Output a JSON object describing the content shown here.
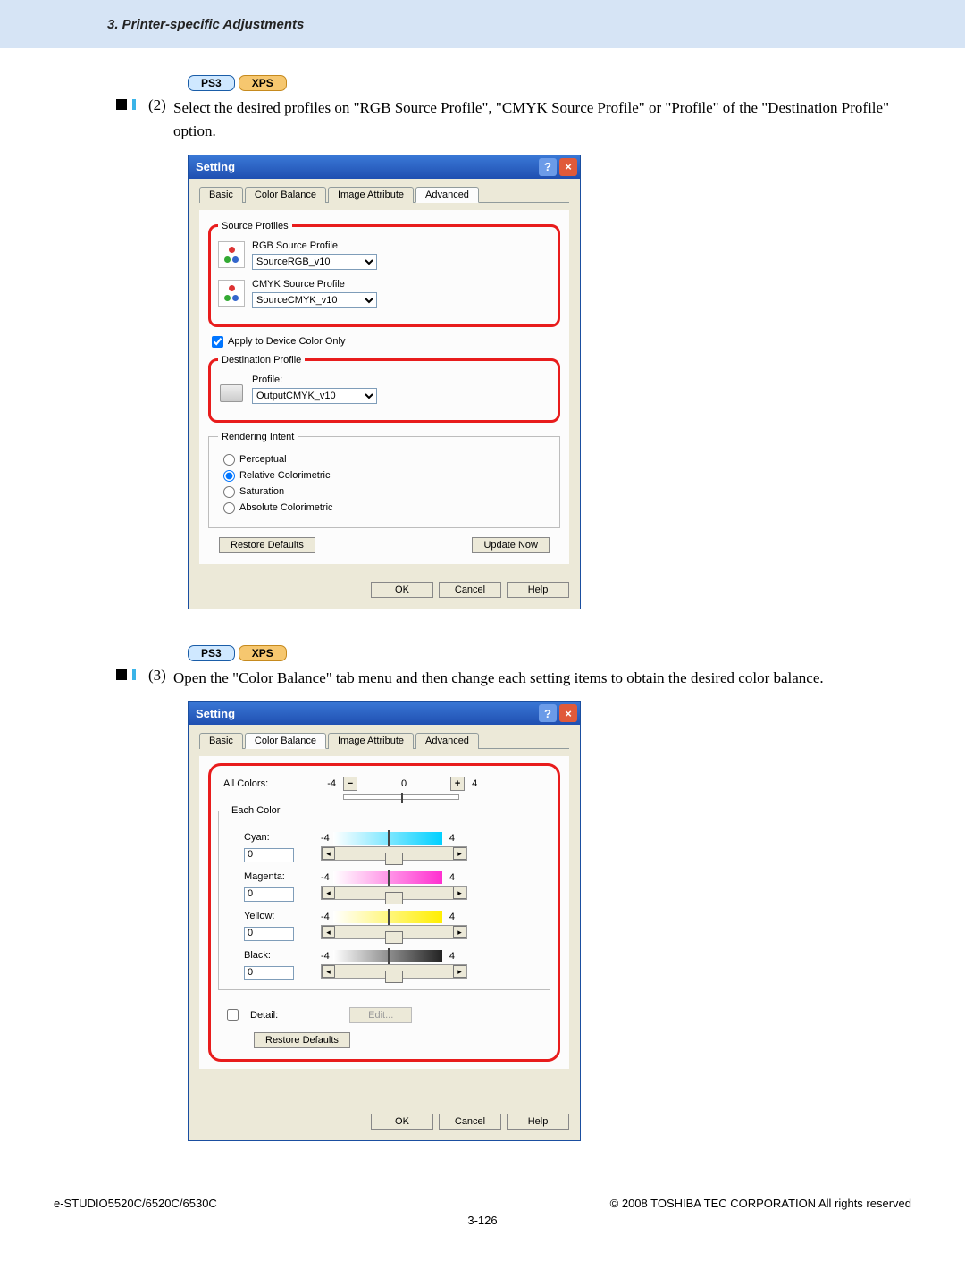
{
  "header": {
    "title": "3. Printer-specific Adjustments"
  },
  "badges": {
    "ps3": "PS3",
    "xps": "XPS"
  },
  "step2": {
    "num": "(2)",
    "text": "Select the desired profiles on \"RGB Source Profile\", \"CMYK Source Profile\" or \"Profile\" of the \"Destination Profile\" option."
  },
  "step3": {
    "num": "(3)",
    "text": "Open the \"Color Balance\" tab menu and then change each setting items to obtain the desired color balance."
  },
  "dialog1": {
    "title": "Setting",
    "tabs": {
      "basic": "Basic",
      "color_balance": "Color Balance",
      "image_attr": "Image Attribute",
      "advanced": "Advanced"
    },
    "source_profiles_legend": "Source Profiles",
    "rgb_label": "RGB Source Profile",
    "rgb_value": "SourceRGB_v10",
    "cmyk_label": "CMYK Source Profile",
    "cmyk_value": "SourceCMYK_v10",
    "apply_device": "Apply to Device Color Only",
    "dest_legend": "Destination Profile",
    "dest_label": "Profile:",
    "dest_value": "OutputCMYK_v10",
    "ri_legend": "Rendering Intent",
    "ri_perceptual": "Perceptual",
    "ri_relative": "Relative Colorimetric",
    "ri_saturation": "Saturation",
    "ri_absolute": "Absolute Colorimetric",
    "restore": "Restore Defaults",
    "update": "Update Now",
    "ok": "OK",
    "cancel": "Cancel",
    "help": "Help"
  },
  "dialog2": {
    "title": "Setting",
    "tabs": {
      "basic": "Basic",
      "color_balance": "Color Balance",
      "image_attr": "Image Attribute",
      "advanced": "Advanced"
    },
    "all_colors": "All Colors:",
    "scale": {
      "neg": "-4",
      "zero": "0",
      "pos": "4"
    },
    "each_color_legend": "Each Color",
    "cyan": {
      "label": "Cyan:",
      "value": "0",
      "neg": "-4",
      "pos": "4"
    },
    "magenta": {
      "label": "Magenta:",
      "value": "0",
      "neg": "-4",
      "pos": "4"
    },
    "yellow": {
      "label": "Yellow:",
      "value": "0",
      "neg": "-4",
      "pos": "4"
    },
    "black": {
      "label": "Black:",
      "value": "0",
      "neg": "-4",
      "pos": "4"
    },
    "detail": "Detail:",
    "edit": "Edit...",
    "restore": "Restore Defaults",
    "ok": "OK",
    "cancel": "Cancel",
    "help": "Help"
  },
  "footer": {
    "left": "e-STUDIO5520C/6520C/6530C",
    "right": "© 2008 TOSHIBA TEC CORPORATION All rights reserved",
    "page": "3-126"
  }
}
